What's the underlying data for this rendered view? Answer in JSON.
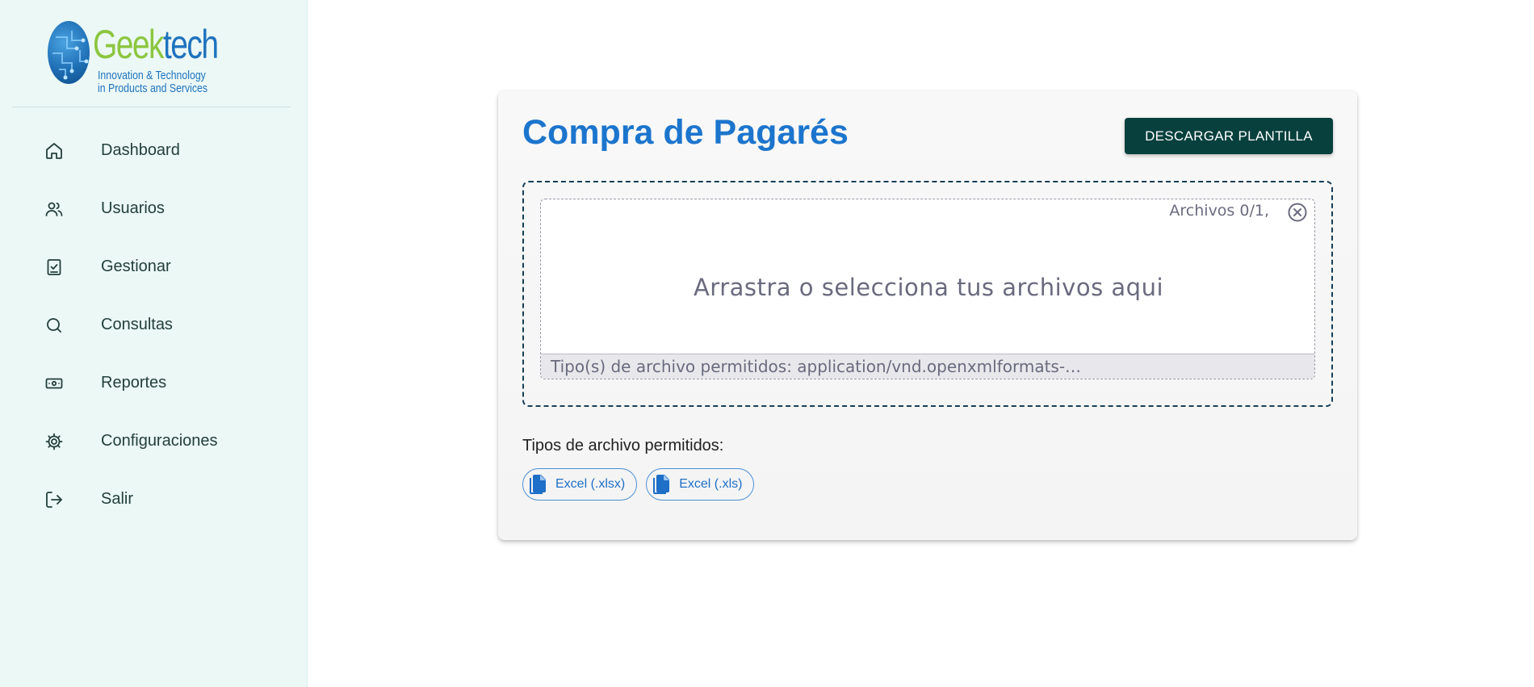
{
  "brand": {
    "name_part1": "Geek",
    "name_part2": "tech",
    "tagline_line1": "Innovation & Technology",
    "tagline_line2": "in Products and Services",
    "colors": {
      "green": "#8cc63f",
      "blue": "#1e73be"
    }
  },
  "sidebar": {
    "items": [
      {
        "label": "Dashboard",
        "icon": "home-icon"
      },
      {
        "label": "Usuarios",
        "icon": "users-icon"
      },
      {
        "label": "Gestionar",
        "icon": "clipboard-check-icon"
      },
      {
        "label": "Consultas",
        "icon": "search-icon"
      },
      {
        "label": "Reportes",
        "icon": "banknote-icon"
      },
      {
        "label": "Configuraciones",
        "icon": "gear-icon"
      },
      {
        "label": "Salir",
        "icon": "logout-icon"
      }
    ]
  },
  "main": {
    "title": "Compra de Pagarés",
    "download_button": "DESCARGAR PLANTILLA",
    "dropzone": {
      "counter": "Archivos 0/1,",
      "prompt": "Arrastra o selecciona tus archivos aqui",
      "allowed_types_text": "Tipo(s) de archivo permitidos: application/vnd.openxmlformats-…"
    },
    "allowed_label": "Tipos de archivo permitidos:",
    "chips": [
      {
        "label": "Excel (.xlsx)",
        "icon": "file-copy-icon"
      },
      {
        "label": "Excel (.xls)",
        "icon": "file-copy-icon"
      }
    ]
  },
  "colors": {
    "sidebar_bg": "#ebf8f6",
    "title_blue": "#1c75cd",
    "button_dark_green": "#07403d",
    "dropzone_border": "#173e5a"
  }
}
